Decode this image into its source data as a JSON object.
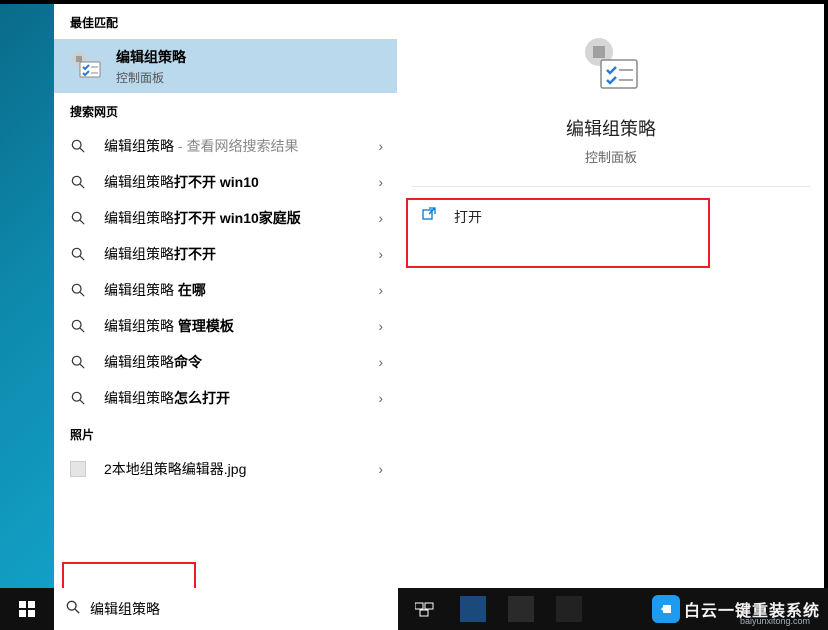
{
  "sections": {
    "best_match_header": "最佳匹配",
    "web_header": "搜索网页",
    "photos_header": "照片"
  },
  "best_match": {
    "title": "编辑组策略",
    "subtitle": "控制面板"
  },
  "web_items": [
    {
      "prefix": "编辑组策略",
      "bold": "",
      "suffix": " - 查看网络搜索结果",
      "suffix_gray": true
    },
    {
      "prefix": "编辑组策略",
      "bold": "打不开 win10",
      "suffix": ""
    },
    {
      "prefix": "编辑组策略",
      "bold": "打不开 win10家庭版",
      "suffix": ""
    },
    {
      "prefix": "编辑组策略",
      "bold": "打不开",
      "suffix": ""
    },
    {
      "prefix": "编辑组策略 ",
      "bold": "在哪",
      "suffix": ""
    },
    {
      "prefix": "编辑组策略 ",
      "bold": "管理模板",
      "suffix": ""
    },
    {
      "prefix": "编辑组策略",
      "bold": "命令",
      "suffix": ""
    },
    {
      "prefix": "编辑组策略",
      "bold": "怎么打开",
      "suffix": ""
    }
  ],
  "photo_items": [
    {
      "label": "2本地组策略编辑器.jpg"
    }
  ],
  "details": {
    "title": "编辑组策略",
    "subtitle": "控制面板",
    "actions": [
      {
        "label": "打开"
      }
    ]
  },
  "search_input": {
    "value": "编辑组策略"
  },
  "watermark": {
    "main": "白云一键重装系统",
    "url": "baiyunxitong.com"
  }
}
